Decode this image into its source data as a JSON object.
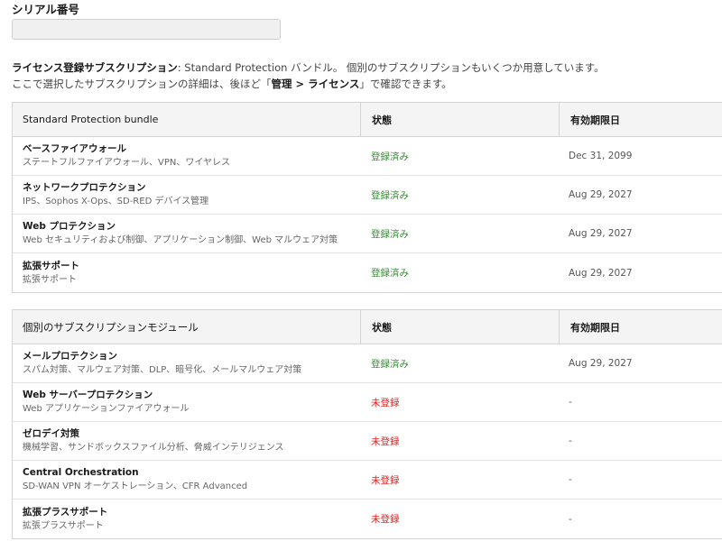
{
  "serial": {
    "label": "シリアル番号",
    "value": ""
  },
  "intro": {
    "line1_bold": "ライセンス登録サブスクリプション",
    "line1_rest": ": Standard Protection バンドル。 個別のサブスクリプションもいくつか用意しています。",
    "line2_pre": "ここで選択したサブスクリプションの詳細は、後ほど「",
    "line2_bold": "管理 > ライセンス",
    "line2_post": "」で確認できます。"
  },
  "bundle_table": {
    "headers": [
      "Standard Protection bundle",
      "状態",
      "有効期限日"
    ],
    "rows": [
      {
        "name": "ベースファイアウォール",
        "desc": "ステートフルファイアウォール、VPN、ワイヤレス",
        "status": "登録済み",
        "status_type": "registered",
        "expiry": "Dec 31, 2099"
      },
      {
        "name": "ネットワークプロテクション",
        "desc": "IPS、Sophos X-Ops、SD-RED デバイス管理",
        "status": "登録済み",
        "status_type": "registered",
        "expiry": "Aug 29, 2027"
      },
      {
        "name": "Web プロテクション",
        "desc": "Web セキュリティおよび制御、アプリケーション制御、Web マルウェア対策",
        "status": "登録済み",
        "status_type": "registered",
        "expiry": "Aug 29, 2027"
      },
      {
        "name": "拡張サポート",
        "desc": "拡張サポート",
        "status": "登録済み",
        "status_type": "registered",
        "expiry": "Aug 29, 2027"
      }
    ]
  },
  "module_table": {
    "headers": [
      "個別のサブスクリプションモジュール",
      "状態",
      "有効期限日"
    ],
    "rows": [
      {
        "name": "メールプロテクション",
        "desc": "スパム対策、マルウェア対策、DLP、暗号化、メールマルウェア対策",
        "status": "登録済み",
        "status_type": "registered",
        "expiry": "Aug 29, 2027"
      },
      {
        "name": "Web サーバープロテクション",
        "desc": "Web アプリケーションファイアウォール",
        "status": "未登録",
        "status_type": "unregistered",
        "expiry": "-"
      },
      {
        "name": "ゼロデイ対策",
        "desc": "機械学習、サンドボックスファイル分析、脅威インテリジェンス",
        "status": "未登録",
        "status_type": "unregistered",
        "expiry": "-"
      },
      {
        "name": "Central Orchestration",
        "desc": "SD-WAN VPN オーケストレーション、CFR Advanced",
        "status": "未登録",
        "status_type": "unregistered",
        "expiry": "-"
      },
      {
        "name": "拡張プラスサポート",
        "desc": "拡張プラスサポート",
        "status": "未登録",
        "status_type": "unregistered",
        "expiry": "-"
      }
    ]
  },
  "colors": {
    "registered": "#3a8a3a",
    "unregistered": "#e02020",
    "header_bg": "#f4f4f4",
    "border": "#d4d4d4"
  }
}
